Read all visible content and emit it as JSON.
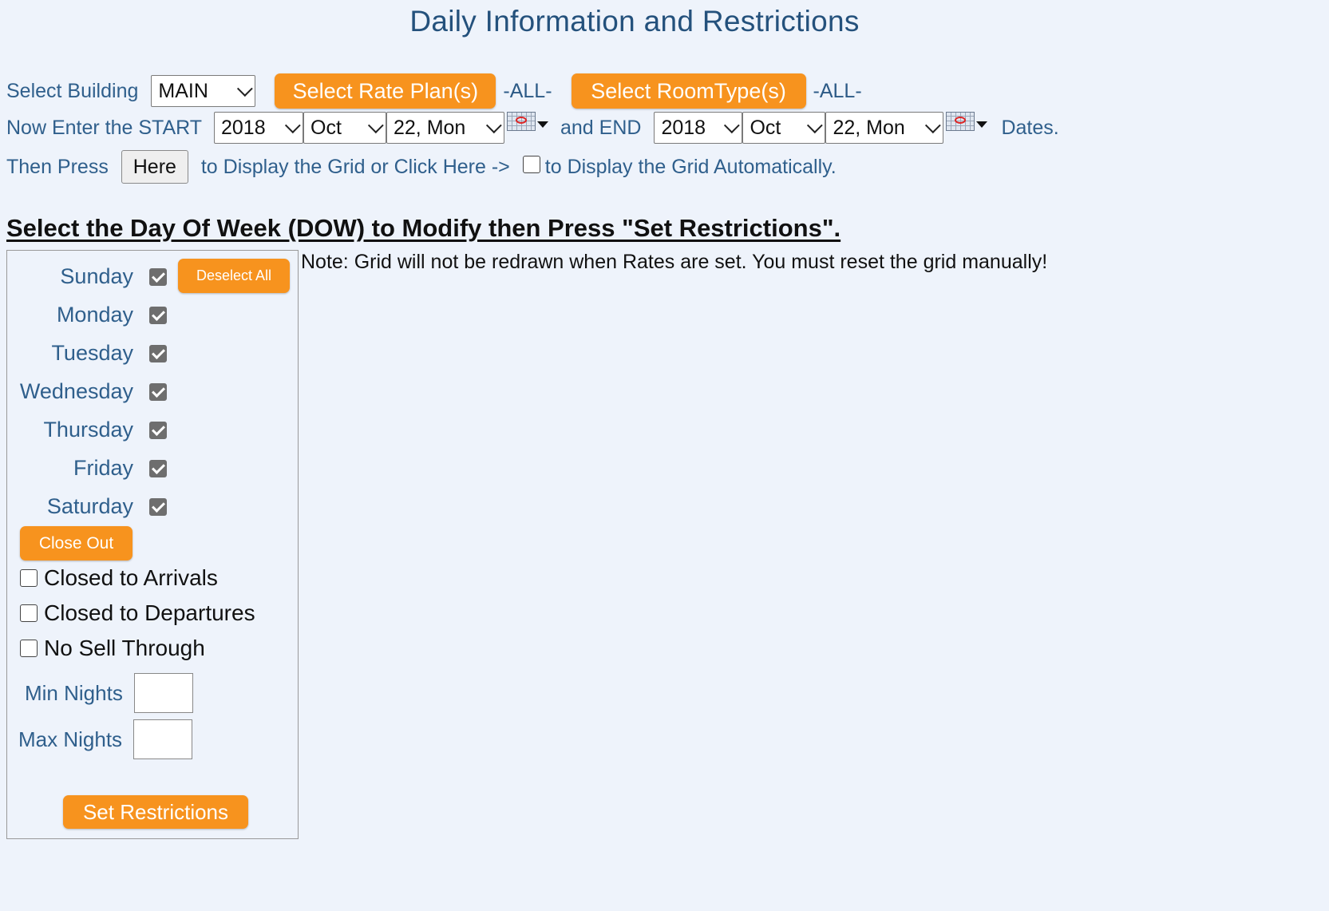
{
  "page": {
    "title": "Daily Information and Restrictions"
  },
  "filters": {
    "building_label": "Select Building",
    "building_value": "MAIN",
    "rate_plan_button": "Select Rate Plan(s)",
    "rate_plan_value": "-ALL-",
    "room_type_button": "Select RoomType(s)",
    "room_type_value": "-ALL-"
  },
  "dates": {
    "start_label": "Now Enter the START",
    "start_year": "2018",
    "start_month": "Oct",
    "start_day": "22, Mon",
    "and_end_label": "and END",
    "end_year": "2018",
    "end_month": "Oct",
    "end_day": "22, Mon",
    "dates_label": "Dates."
  },
  "display": {
    "then_press_label": "Then Press",
    "here_button": "Here",
    "middle_text": "to Display the Grid or Click Here ->",
    "auto_label": "to Display the Grid Automatically.",
    "auto_checked": false
  },
  "restrictions": {
    "heading": "Select the Day Of Week (DOW) to Modify then Press \"Set Restrictions\".",
    "note": "Note: Grid will not be redrawn when Rates are set. You must reset the grid manually!",
    "deselect_all_button": "Deselect All",
    "days": [
      {
        "label": "Sunday",
        "checked": true
      },
      {
        "label": "Monday",
        "checked": true
      },
      {
        "label": "Tuesday",
        "checked": true
      },
      {
        "label": "Wednesday",
        "checked": true
      },
      {
        "label": "Thursday",
        "checked": true
      },
      {
        "label": "Friday",
        "checked": true
      },
      {
        "label": "Saturday",
        "checked": true
      }
    ],
    "close_out_button": "Close Out",
    "options": [
      {
        "label": "Closed to Arrivals",
        "checked": false
      },
      {
        "label": "Closed to Departures",
        "checked": false
      },
      {
        "label": "No Sell Through",
        "checked": false
      }
    ],
    "min_nights_label": "Min Nights",
    "min_nights_value": "",
    "max_nights_label": "Max Nights",
    "max_nights_value": "",
    "set_button": "Set Restrictions"
  }
}
